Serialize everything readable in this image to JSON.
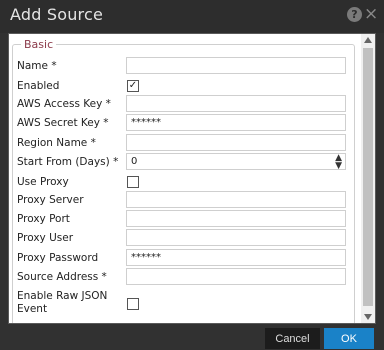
{
  "dialog": {
    "title": "Add Source",
    "help_icon": "?",
    "close_icon": "×"
  },
  "form": {
    "section_title": "Basic",
    "fields": [
      {
        "label": "Name *",
        "type": "text",
        "value": ""
      },
      {
        "label": "Enabled",
        "type": "checkbox",
        "checked": true
      },
      {
        "label": "AWS Access Key *",
        "type": "text",
        "value": ""
      },
      {
        "label": "AWS Secret Key *",
        "type": "password",
        "value": "******"
      },
      {
        "label": "Region Name *",
        "type": "text",
        "value": ""
      },
      {
        "label": "Start From (Days) *",
        "type": "number",
        "value": "0"
      },
      {
        "label": "Use Proxy",
        "type": "checkbox",
        "checked": false
      },
      {
        "label": "Proxy Server",
        "type": "text",
        "value": ""
      },
      {
        "label": "Proxy Port",
        "type": "text",
        "value": ""
      },
      {
        "label": "Proxy User",
        "type": "text",
        "value": ""
      },
      {
        "label": "Proxy Password",
        "type": "password",
        "value": "******"
      },
      {
        "label": "Source Address *",
        "type": "text",
        "value": ""
      },
      {
        "label": "Enable Raw JSON",
        "label2": "Event",
        "type": "checkbox",
        "checked": false
      }
    ]
  },
  "footer": {
    "cancel_label": "Cancel",
    "ok_label": "OK"
  },
  "colors": {
    "ok_button": "#1a82c8",
    "legend_text": "#8b3a4a"
  }
}
